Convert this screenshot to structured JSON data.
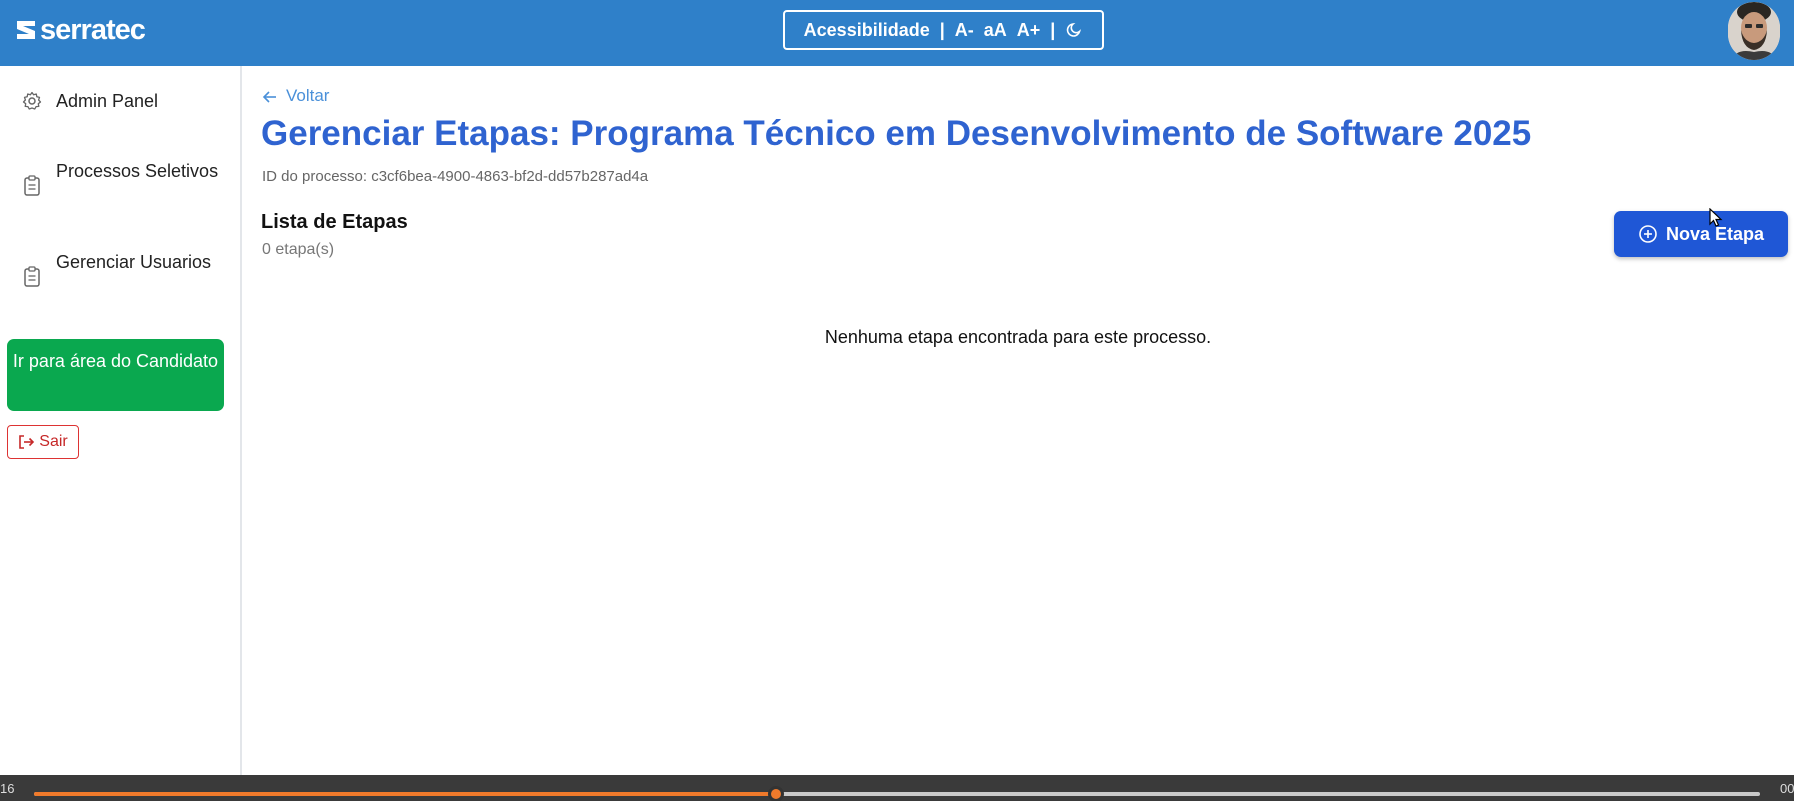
{
  "header": {
    "brand": "serratec",
    "accessibility": {
      "label": "Acessibilidade",
      "separator": "|",
      "decrease": "A-",
      "reset": "aA",
      "increase": "A+",
      "dark_mode_icon": "moon-icon"
    },
    "avatar_icon": "user-avatar"
  },
  "sidebar": {
    "items": [
      {
        "label": "Admin Panel",
        "icon": "gear-icon"
      },
      {
        "label": "Processos Seletivos",
        "icon": "clipboard-icon"
      },
      {
        "label": "Gerenciar Usuarios",
        "icon": "clipboard-icon"
      }
    ],
    "candidate_button": "Ir para área do Candidato",
    "logout_button": "Sair"
  },
  "main": {
    "back_link": "Voltar",
    "title": "Gerenciar Etapas: Programa Técnico em Desenvolvimento de Software 2025",
    "process_id": "ID do processo: c3cf6bea-4900-4863-bf2d-dd57b287ad4a",
    "list_title": "Lista de Etapas",
    "list_count": "0 etapa(s)",
    "new_button": "Nova Etapa",
    "empty_message": "Nenhuma etapa encontrada para este processo."
  },
  "video": {
    "time_left": "16",
    "time_right": "00",
    "progress": 0.43
  },
  "colors": {
    "header": "#2f80c9",
    "title": "#2f63d0",
    "primary_button": "#1f57d6",
    "candidate_button": "#0aa84f",
    "logout": "#c62828",
    "progress": "#f07a2b"
  }
}
